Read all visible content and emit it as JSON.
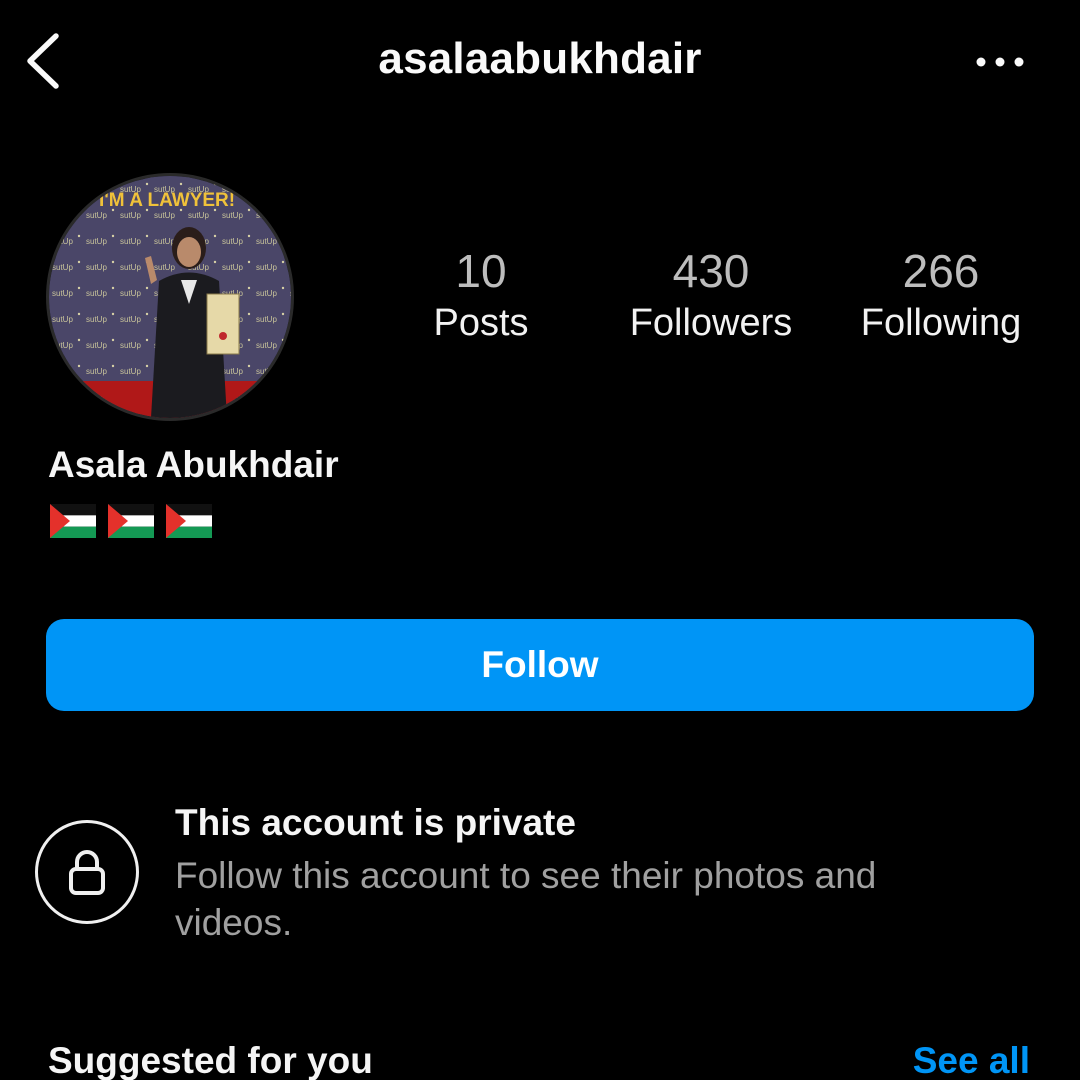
{
  "header": {
    "username": "asalaabukhdair",
    "back_icon": "chevron-left-icon",
    "more_icon": "more-horizontal-icon"
  },
  "profile": {
    "avatar_banner_text": "I'M A LAWYER!",
    "display_name": "Asala Abukhdair",
    "bio_flags": [
      "palestine-flag",
      "palestine-flag",
      "palestine-flag"
    ]
  },
  "stats": [
    {
      "value": "10",
      "label": "Posts"
    },
    {
      "value": "430",
      "label": "Followers"
    },
    {
      "value": "266",
      "label": "Following"
    }
  ],
  "follow_button": {
    "label": "Follow",
    "color": "#0095f6"
  },
  "private_notice": {
    "title": "This account is private",
    "description": "Follow this account to see their photos and videos.",
    "icon": "lock-icon"
  },
  "suggested": {
    "title": "Suggested for you",
    "see_all_label": "See all",
    "link_color": "#0095f6"
  },
  "colors": {
    "background": "#000000",
    "text_primary": "#f5f5f5",
    "text_secondary": "#a0a0a0",
    "stat_value": "#bdbdbd"
  }
}
